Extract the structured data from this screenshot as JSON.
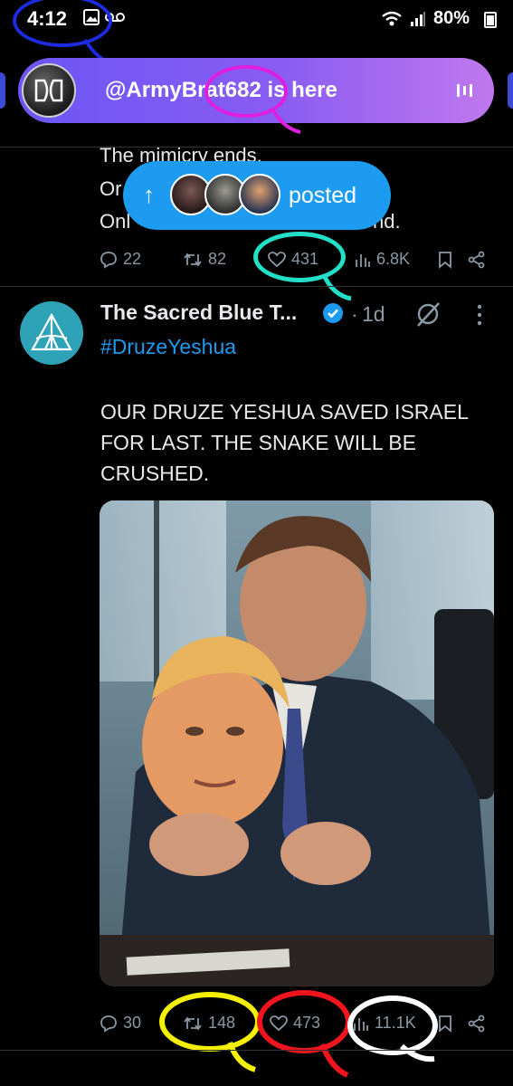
{
  "status_bar": {
    "time": "4:12",
    "battery": "80%"
  },
  "spaces_banner": {
    "text": "@ArmyBrat682 is here"
  },
  "previous_tweet": {
    "line1": "The mimicry ends.",
    "line2": "Or",
    "line3": "Onl",
    "line3_end": "nd.",
    "replies": "22",
    "reposts": "82",
    "likes": "431",
    "views": "6.8K"
  },
  "new_posts_pill": {
    "label": "posted"
  },
  "tweet": {
    "author_name": "The Sacred Blue T...",
    "time": "1d",
    "separator": "·",
    "hashtag": "#DruzeYeshua",
    "body": "OUR DRUZE YESHUA SAVED ISRAEL FOR LAST. THE SNAKE WILL BE CRUSHED.",
    "replies": "30",
    "reposts": "148",
    "likes": "473",
    "views": "11.1K"
  },
  "colors": {
    "accent": "#1d9bf0",
    "marker_blue": "#1d2be0",
    "marker_magenta": "#e01ee0",
    "marker_cyan": "#22e0c8",
    "marker_yellow": "#f5f000",
    "marker_red": "#f0141e",
    "marker_white": "#ffffff"
  }
}
